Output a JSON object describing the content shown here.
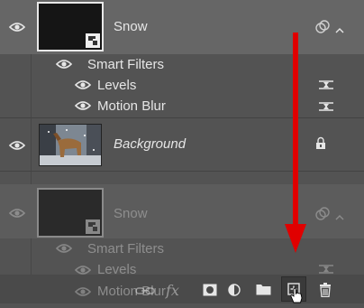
{
  "layers": [
    {
      "name": "Snow",
      "smart_filters_label": "Smart Filters",
      "filters": [
        "Levels",
        "Motion Blur"
      ]
    },
    {
      "name": "Background"
    }
  ],
  "ghost_layer": {
    "name": "Snow",
    "smart_filters_label": "Smart Filters",
    "filters": [
      "Levels",
      "Motion Blur"
    ]
  },
  "toolbar": {
    "icons": [
      "link-icon",
      "fx-icon",
      "mask-icon",
      "adjustment-icon",
      "folder-icon",
      "new-layer-icon",
      "trash-icon"
    ]
  },
  "colors": {
    "panel": "#535353",
    "selected_row": "#666666",
    "arrow": "#e00000"
  }
}
